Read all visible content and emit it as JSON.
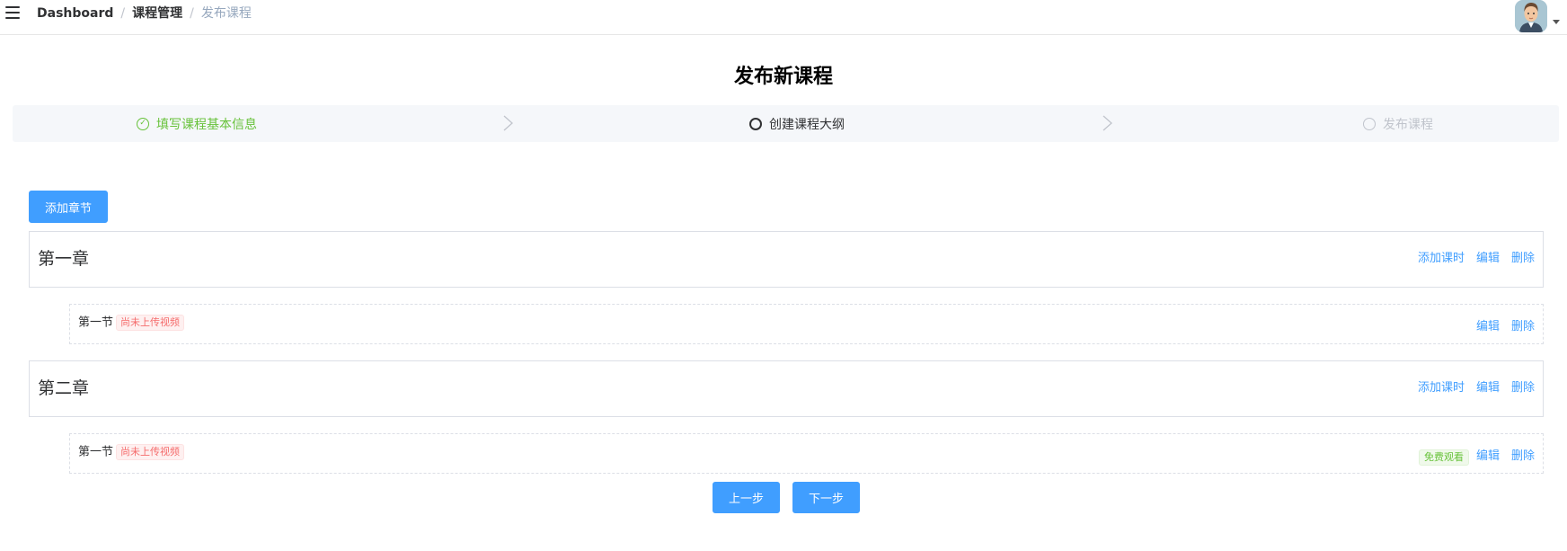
{
  "breadcrumb": [
    "Dashboard",
    "课程管理",
    "发布课程"
  ],
  "breadcrumb_separator": "/",
  "page_title": "发布新课程",
  "steps": [
    {
      "label": "填写课程基本信息",
      "status": "success"
    },
    {
      "label": "创建课程大纲",
      "status": "process"
    },
    {
      "label": "发布课程",
      "status": "wait"
    }
  ],
  "add_chapter_label": "添加章节",
  "chapters": [
    {
      "title": "第一章",
      "actions": [
        "添加课时",
        "编辑",
        "删除"
      ],
      "sections": [
        {
          "title": "第一节",
          "video_tag": "尚未上传视频",
          "actions": [
            "编辑",
            "删除"
          ]
        }
      ]
    },
    {
      "title": "第二章",
      "actions": [
        "添加课时",
        "编辑",
        "删除"
      ],
      "sections": [
        {
          "title": "第一节",
          "video_tag": "尚未上传视频",
          "free_tag": "免费观看",
          "actions": [
            "编辑",
            "删除"
          ]
        }
      ]
    }
  ],
  "prev_label": "上一步",
  "next_label": "下一步",
  "colors": {
    "primary": "#409eff",
    "success": "#67c23a",
    "danger": "#f56c6c",
    "wait": "#c0c4cc"
  },
  "icons": {
    "menu": "hamburger-icon",
    "step_done": "check-circle-icon",
    "step_arrow": "chevron-right-icon",
    "user": "avatar"
  }
}
